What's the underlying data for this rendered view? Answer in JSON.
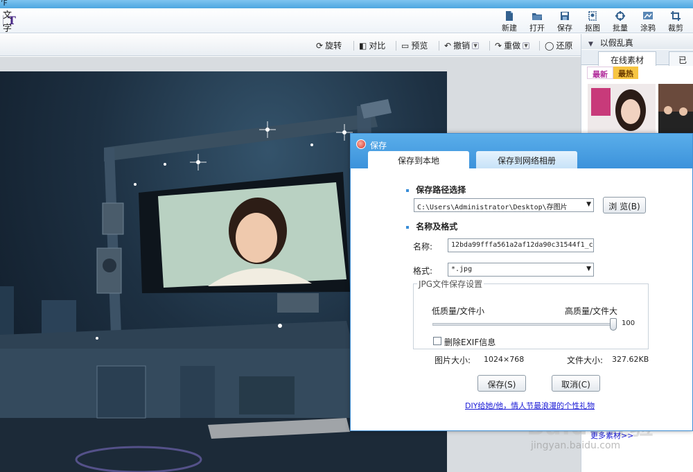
{
  "titlebar": {
    "text": "‘F"
  },
  "toolbar": {
    "text_tool_label": "文字",
    "buttons": [
      {
        "label": "新建",
        "icon": "new-file-icon"
      },
      {
        "label": "打开",
        "icon": "open-folder-icon"
      },
      {
        "label": "保存",
        "icon": "save-icon"
      },
      {
        "label": "抠图",
        "icon": "cutout-icon"
      },
      {
        "label": "批量",
        "icon": "batch-icon"
      },
      {
        "label": "涂鸦",
        "icon": "doodle-icon"
      },
      {
        "label": "裁剪",
        "icon": "crop-icon"
      }
    ]
  },
  "editbar": {
    "rotate": "旋转",
    "compare": "对比",
    "preview": "预览",
    "undo": "撤销",
    "redo": "重做",
    "restore": "还原"
  },
  "right_panel": {
    "header": "以假乱真",
    "tabs": [
      "在线素材",
      "已"
    ],
    "subtabs": [
      "最新",
      "最热"
    ]
  },
  "dialog": {
    "title": "保存",
    "tabs": [
      "保存到本地",
      "保存到网络相册"
    ],
    "section_path": "保存路径选择",
    "path_value": "C:\\Users\\Administrator\\Desktop\\存图片",
    "browse_button": "浏 览(B)",
    "section_name": "名称及格式",
    "name_label": "名称:",
    "name_value": "12bda99fffa561a2af12da90c31544f1_co",
    "format_label": "格式:",
    "format_value": "*.jpg",
    "jpg_group_title": "JPG文件保存设置",
    "low_quality": "低质量/文件小",
    "high_quality": "高质量/文件大",
    "quality_value": "100",
    "quality_level": 1.0,
    "remove_exif": "删除EXIF信息",
    "image_size_label": "图片大小:",
    "image_size_value": "1024×768",
    "file_size_label": "文件大小:",
    "file_size_value": "327.62KB",
    "save_button": "保存(S)",
    "cancel_button": "取消(C)",
    "promo_link": "DIY给她/他，情人节最浪漫的个性礼物"
  },
  "watermark": {
    "brand": "Baidu经验",
    "url": "jingyan.baidu.com"
  },
  "bottom_link": "更多素材>>"
}
